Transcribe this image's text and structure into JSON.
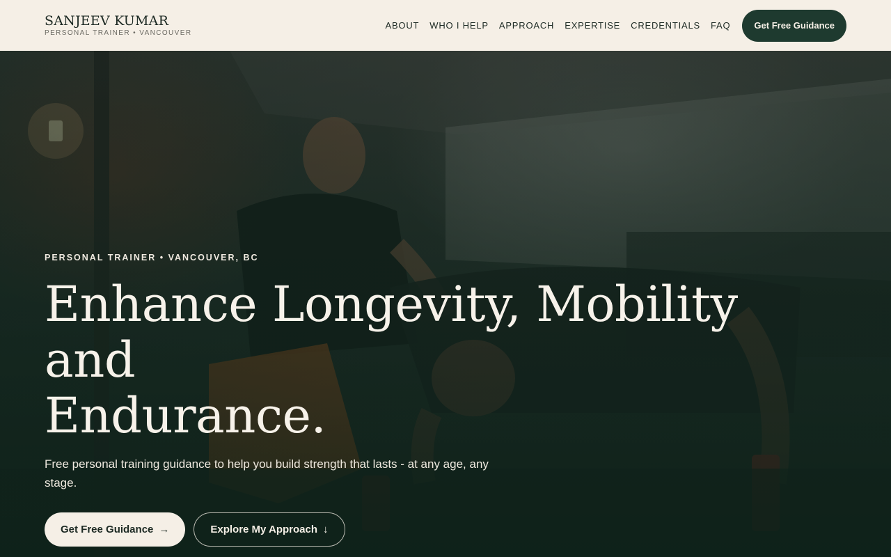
{
  "brand": {
    "name": "SANJEEV KUMAR",
    "tagline": "PERSONAL TRAINER • VANCOUVER"
  },
  "nav": {
    "items": [
      "ABOUT",
      "WHO I HELP",
      "APPROACH",
      "EXPERTISE",
      "CREDENTIALS",
      "FAQ"
    ],
    "cta_label": "Get Free Guidance"
  },
  "hero": {
    "eyebrow": "PERSONAL TRAINER • VANCOUVER, BC",
    "headline_line1": "Enhance Longevity, Mobility and",
    "headline_line2": "Endurance.",
    "subtext": "Free personal training guidance to help you build strength that lasts - at any age, any stage.",
    "primary_cta": "Get Free Guidance",
    "primary_cta_icon": "→",
    "secondary_cta": "Explore My Approach",
    "secondary_cta_icon": "↓"
  },
  "colors": {
    "header_bg": "#f5efe6",
    "brand_dark": "#1e3a2f",
    "text_light": "#f7f2ea"
  }
}
